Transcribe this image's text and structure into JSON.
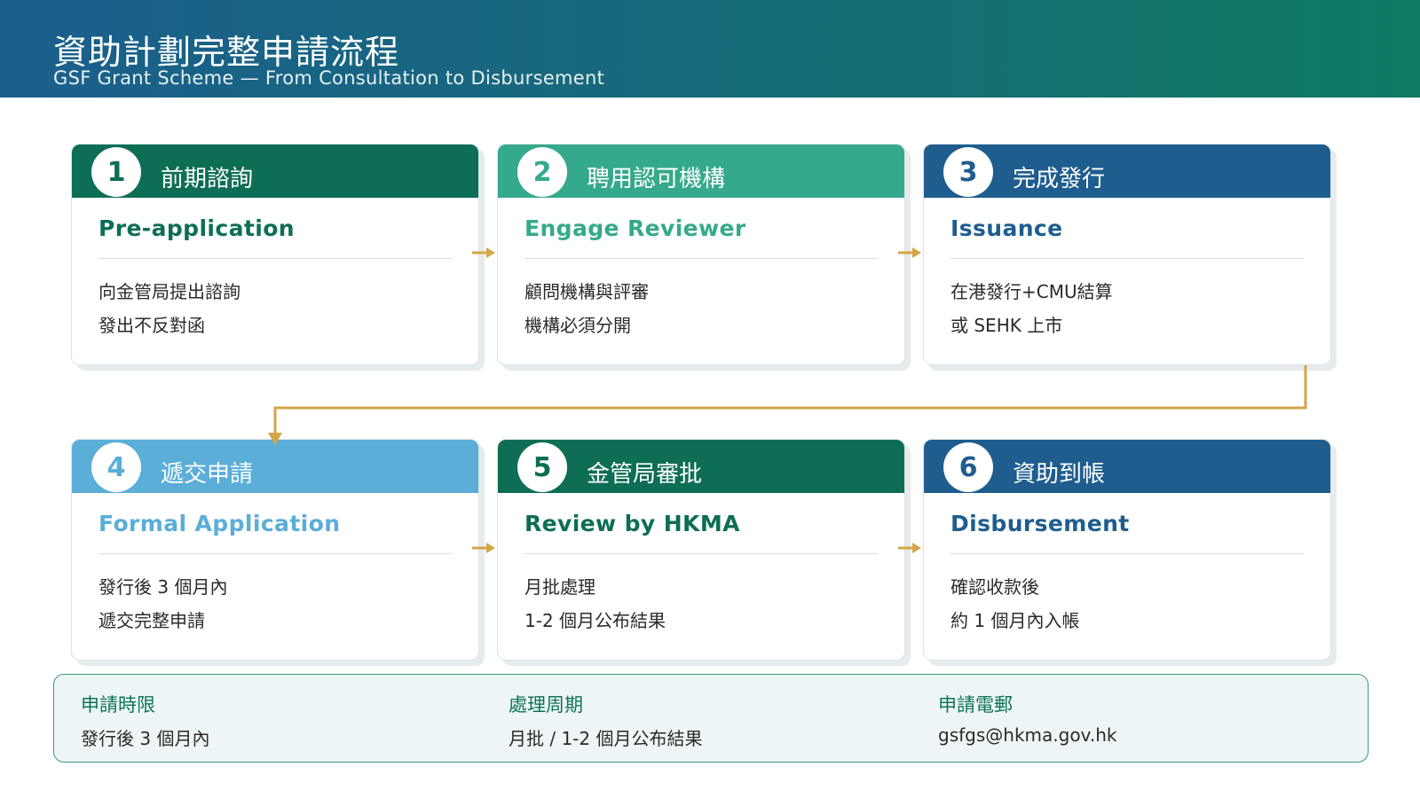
{
  "header": {
    "title": "資助計劃完整申請流程",
    "subtitle": "GSF Grant Scheme — From Consultation to Disbursement"
  },
  "steps": [
    {
      "num": "1",
      "zh": "前期諮詢",
      "en": "Pre-application",
      "line1": "向金管局提出諮詢",
      "line2": "發出不反對函",
      "color": "#0d6e55"
    },
    {
      "num": "2",
      "zh": "聘用認可機構",
      "en": "Engage Reviewer",
      "line1": "顧問機構與評審",
      "line2": "機構必須分開",
      "color": "#35a98c"
    },
    {
      "num": "3",
      "zh": "完成發行",
      "en": "Issuance",
      "line1": "在港發行+CMU結算",
      "line2": "或 SEHK 上市",
      "color": "#1e5d8e"
    },
    {
      "num": "4",
      "zh": "遞交申請",
      "en": "Formal Application",
      "line1": "發行後 3 個月內",
      "line2": "遞交完整申請",
      "color": "#5aaed8"
    },
    {
      "num": "5",
      "zh": "金管局審批",
      "en": "Review by HKMA",
      "line1": "月批處理",
      "line2": "1-2 個月公布結果",
      "color": "#0d6e55"
    },
    {
      "num": "6",
      "zh": "資助到帳",
      "en": "Disbursement",
      "line1": "確認收款後",
      "line2": "約 1 個月內入帳",
      "color": "#1e5d8e"
    }
  ],
  "info": {
    "deadline_label": "申請時限",
    "deadline_value": "發行後 3 個月內",
    "cycle_label": "處理周期",
    "cycle_value": "月批 / 1-2 個月公布結果",
    "email_label": "申請電郵",
    "email_value": "gsfgs@hkma.gov.hk"
  },
  "colors": {
    "arrow": "#d4a548",
    "info_border": "#3a9a80"
  }
}
